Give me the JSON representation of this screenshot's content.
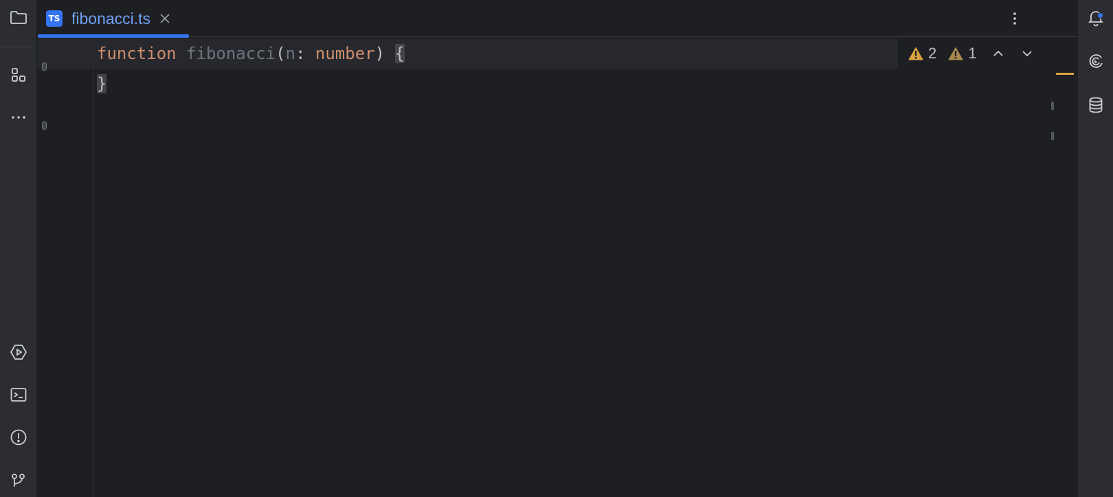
{
  "left_toolbar": {
    "items": [
      {
        "name": "project",
        "icon": "folder-icon"
      },
      {
        "name": "structure",
        "icon": "structure-icon"
      },
      {
        "name": "more",
        "icon": "more-horizontal-icon",
        "label": "···"
      },
      {
        "name": "services",
        "icon": "run-services-icon"
      },
      {
        "name": "terminal",
        "icon": "terminal-icon"
      },
      {
        "name": "problems",
        "icon": "problems-icon"
      },
      {
        "name": "git",
        "icon": "git-icon"
      }
    ]
  },
  "right_toolbar": {
    "items": [
      {
        "name": "notifications",
        "icon": "bell-icon",
        "has_badge": true
      },
      {
        "name": "ai-assistant",
        "icon": "ai-spiral-icon"
      },
      {
        "name": "database",
        "icon": "database-icon"
      }
    ]
  },
  "tab": {
    "badge": "TS",
    "label": "fibonacci.ts",
    "active": true
  },
  "code": {
    "line1": {
      "keyword": "function",
      "space1": " ",
      "fn_name": "fibonacci",
      "open_paren": "(",
      "param": "n",
      "colon": ": ",
      "type": "number",
      "close_paren": ") ",
      "brace": "{"
    },
    "line2": {
      "brace": "}"
    }
  },
  "inspections": {
    "warnings": "2",
    "weak_warnings": "1"
  },
  "colors": {
    "accent": "#3574f0",
    "warning": "#d9a343",
    "weak_warning": "#a88a4e",
    "keyword": "#cf8e6d"
  }
}
